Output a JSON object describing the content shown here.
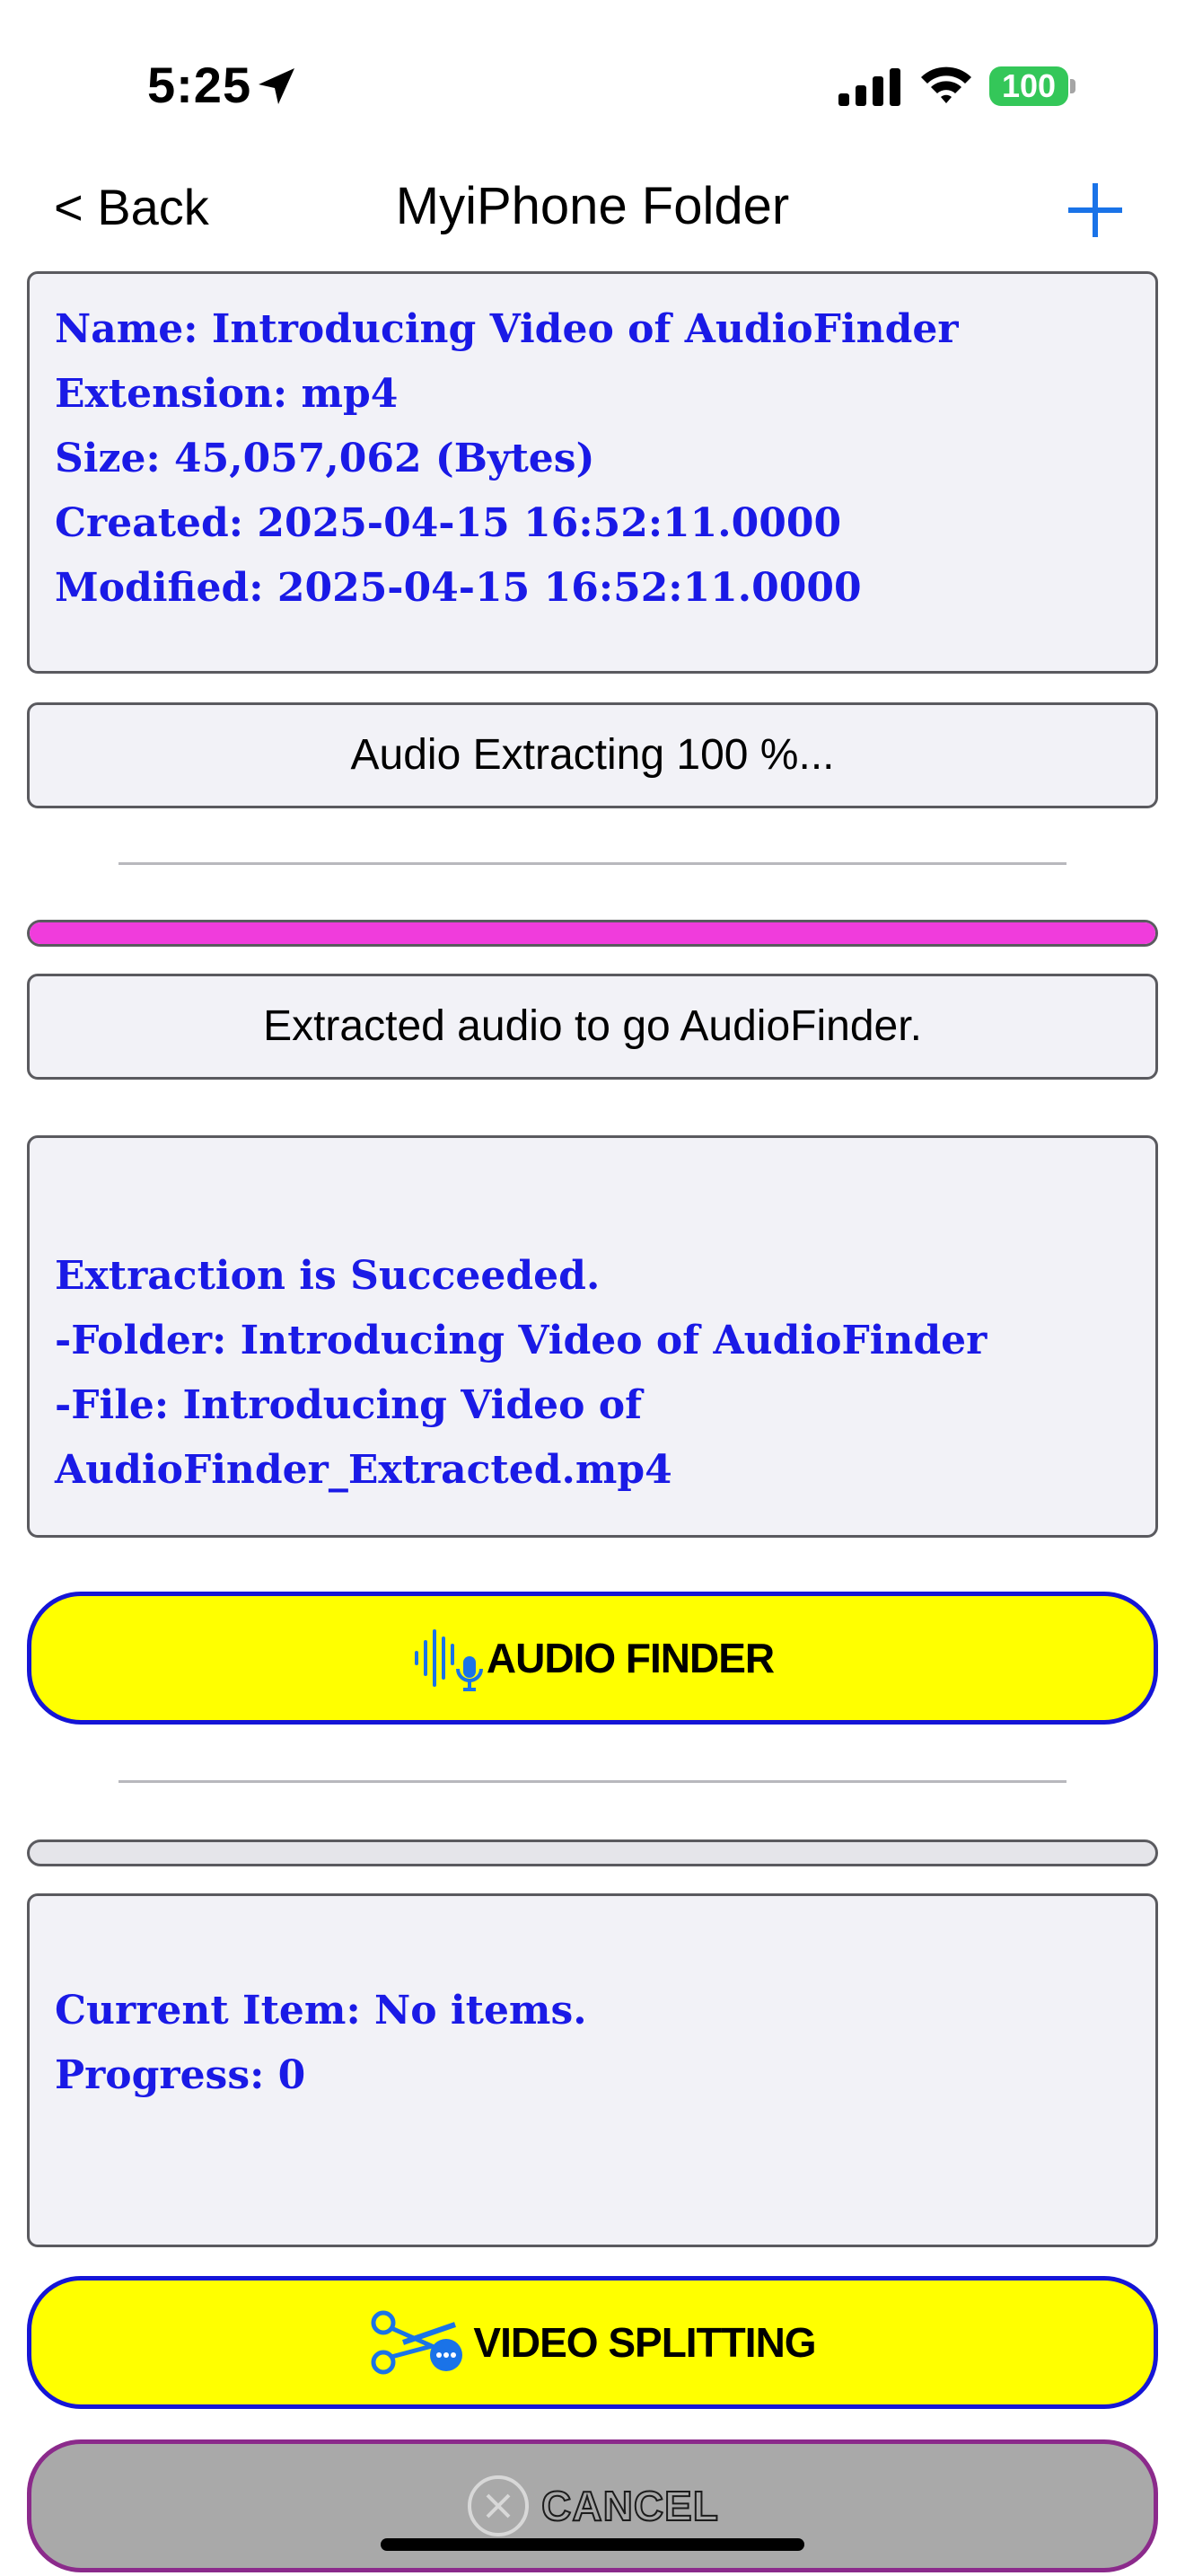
{
  "status_bar": {
    "time": "5:25",
    "battery": "100",
    "icons": [
      "location-arrow-icon",
      "cellular-signal-icon",
      "wifi-icon",
      "battery-icon"
    ]
  },
  "nav": {
    "back_label": "< Back",
    "title": "MyiPhone Folder",
    "add_icon": "plus-icon"
  },
  "file_info": {
    "name": "Name: Introducing Video of AudioFinder",
    "extension": "Extension: mp4",
    "size": "Size: 45,057,062 (Bytes)",
    "created": "Created: 2025-04-15 16:52:11.0000",
    "modified": "Modified: 2025-04-15 16:52:11.0000"
  },
  "extract": {
    "status_label": "Audio Extracting 100 %...",
    "progress_fraction": 1.0,
    "goto_label": "Extracted audio to go AudioFinder.",
    "result_lines": [
      "Extraction is Succeeded.",
      "-Folder:  Introducing Video of AudioFinder",
      "-File:  Introducing Video of AudioFinder_Extracted.mp4"
    ],
    "audio_finder_label": "AUDIO FINDER",
    "audio_finder_icon": "waveform-mic-icon"
  },
  "split": {
    "progress_fraction": 0,
    "current_item": "Current Item: No items.",
    "progress": "Progress: 0",
    "video_splitting_label": "VIDEO SPLITTING",
    "video_splitting_icon": "scissors-icon"
  },
  "cancel": {
    "label": "CANCEL",
    "icon": "close-circle-icon"
  },
  "colors": {
    "accent_blue": "#1a1ae6",
    "button_yellow": "#ffff00",
    "progress_magenta": "#f03cdc",
    "nav_blue": "#1a73e8",
    "battery_green": "#34c759"
  }
}
